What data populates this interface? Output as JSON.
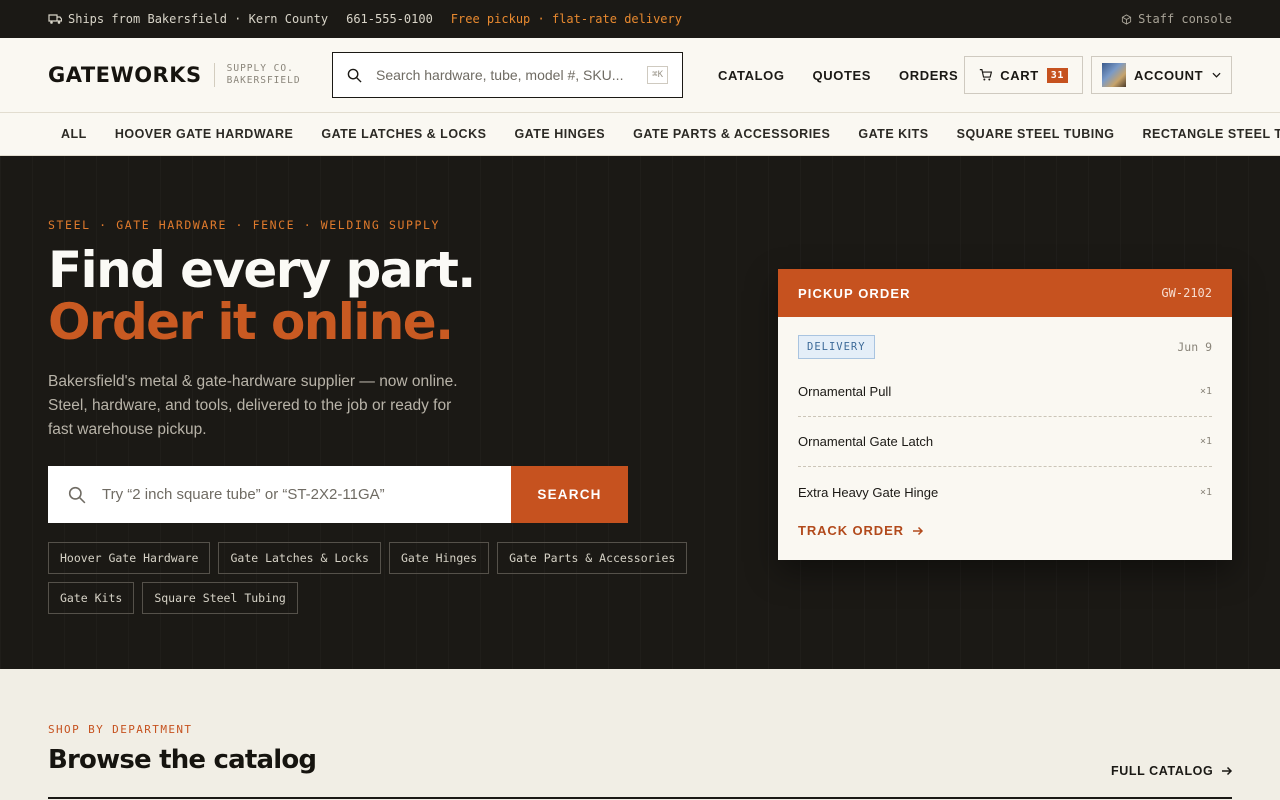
{
  "topbar": {
    "ships_from": "Ships from Bakersfield · Kern County",
    "phone": "661-555-0100",
    "promo": "Free pickup · flat-rate delivery",
    "staff": "Staff console"
  },
  "header": {
    "logo": "GATEWORKS",
    "logo_sub_1": "SUPPLY CO.",
    "logo_sub_2": "BAKERSFIELD",
    "search_placeholder": "Search hardware, tube, model #, SKU...",
    "search_shortcut": "⌘K",
    "nav": [
      "CATALOG",
      "QUOTES",
      "ORDERS"
    ],
    "cart_label": "CART",
    "cart_count": "31",
    "account_label": "ACCOUNT"
  },
  "categories": [
    "ALL",
    "HOOVER GATE HARDWARE",
    "GATE LATCHES & LOCKS",
    "GATE HINGES",
    "GATE PARTS & ACCESSORIES",
    "GATE KITS",
    "SQUARE STEEL TUBING",
    "RECTANGLE STEEL T"
  ],
  "hero": {
    "eyebrow": "STEEL · GATE HARDWARE · FENCE · WELDING SUPPLY",
    "headline_1": "Find every part.",
    "headline_2": "Order it online.",
    "lede": "Bakersfield's metal & gate-hardware supplier — now online. Steel, hardware, and tools, delivered to the job or ready for fast warehouse pickup.",
    "search_placeholder": "Try “2 inch square tube” or “ST-2X2-11GA”",
    "search_button": "SEARCH",
    "chips": [
      "Hoover Gate Hardware",
      "Gate Latches & Locks",
      "Gate Hinges",
      "Gate Parts & Accessories",
      "Gate Kits",
      "Square Steel Tubing"
    ]
  },
  "order_card": {
    "title": "PICKUP ORDER",
    "order_id": "GW-2102",
    "status": "DELIVERY",
    "date": "Jun 9",
    "items": [
      {
        "name": "Ornamental Pull",
        "qty": "×1"
      },
      {
        "name": "Ornamental Gate Latch",
        "qty": "×1"
      },
      {
        "name": "Extra Heavy Gate Hinge",
        "qty": "×1"
      }
    ],
    "track_label": "TRACK ORDER"
  },
  "section": {
    "eyebrow": "SHOP BY DEPARTMENT",
    "title": "Browse the catalog",
    "full_catalog": "FULL CATALOG"
  },
  "colors": {
    "accent": "#c6521f",
    "dark": "#1b1915",
    "promo": "#e8892f"
  }
}
